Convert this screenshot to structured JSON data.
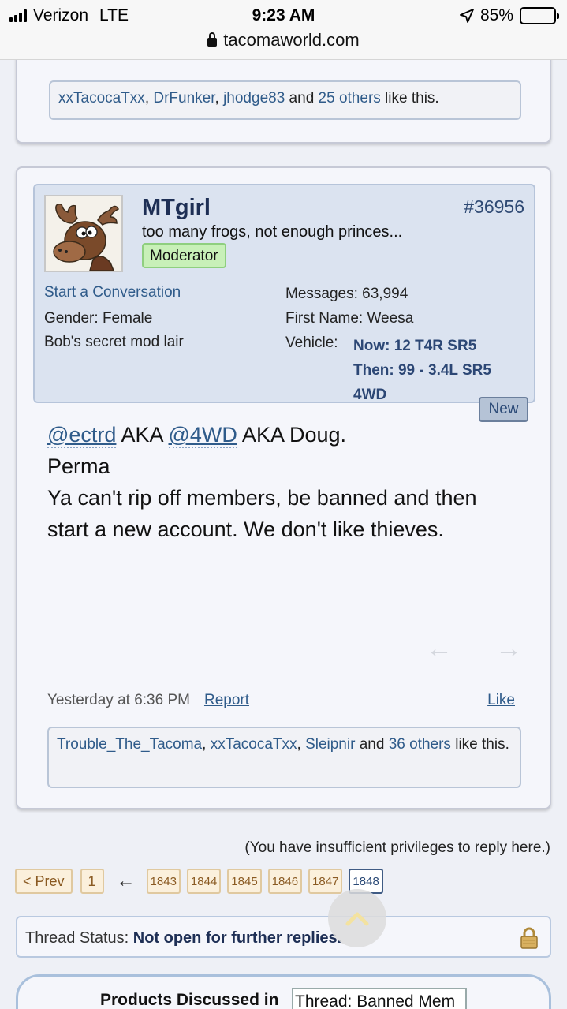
{
  "statusbar": {
    "carrier": "Verizon",
    "network": "LTE",
    "time": "9:23 AM",
    "battery": "85%"
  },
  "browser": {
    "url": "tacomaworld.com"
  },
  "prev_post": {
    "likes": {
      "users": [
        "xxTacocaTxx",
        "DrFunker",
        "jhodge83"
      ],
      "separator": ", ",
      "and": " and ",
      "others_link": "25 others",
      "suffix": " like this."
    }
  },
  "post": {
    "username": "MTgirl",
    "post_number": "#36956",
    "user_title": "too many frogs, not enough princes...",
    "badge": "Moderator",
    "start_conversation": "Start a Conversation",
    "gender_label": "Gender:",
    "gender_value": "Female",
    "extra": "Bob's secret mod lair",
    "messages_label": "Messages:",
    "messages_value": "63,994",
    "first_name_label": "First Name:",
    "first_name_value": "Weesa",
    "vehicle_label": "Vehicle:",
    "vehicle_now": "Now: 12 T4R SR5",
    "vehicle_then_1": "Then: 99 - 3.4L SR5",
    "vehicle_then_2": "4WD",
    "new_badge": "New",
    "message": {
      "mention1": "@ectrd",
      "aka1": " AKA ",
      "mention2": "@4WD",
      "aka2": " AKA Doug.",
      "line2": "Perma",
      "line3": "Ya can't rip off members, be banned and then start a new account. We don't like thieves."
    },
    "timestamp": "Yesterday at 6:36 PM",
    "report": "Report",
    "like": "Like",
    "likes": {
      "user1": "Trouble_The_Tacoma",
      "user2": "xxTacocaTxx",
      "user3": "Sleipnir",
      "sep": ", ",
      "and": " and ",
      "others_link": "36 others",
      "suffix": " like this."
    }
  },
  "reply_notice": "(You have insufficient privileges to reply here.)",
  "pagination": {
    "prev": "< Prev",
    "first": "1",
    "ellipsis_arrow": "←",
    "pages": [
      "1843",
      "1844",
      "1845",
      "1846",
      "1847"
    ],
    "current": "1848"
  },
  "thread_status": {
    "label": "Thread Status:",
    "value": "Not open for further replies."
  },
  "products": {
    "title": "Products Discussed in",
    "select_value": "Thread: Banned Mem"
  },
  "icons": {
    "signal": "cellular-signal-icon",
    "location": "location-arrow-icon",
    "battery": "battery-icon",
    "lock": "lock-icon",
    "back": "arrow-left-icon",
    "forward": "arrow-right-icon",
    "scroll_up": "chevron-up-icon",
    "padlock": "padlock-icon"
  }
}
